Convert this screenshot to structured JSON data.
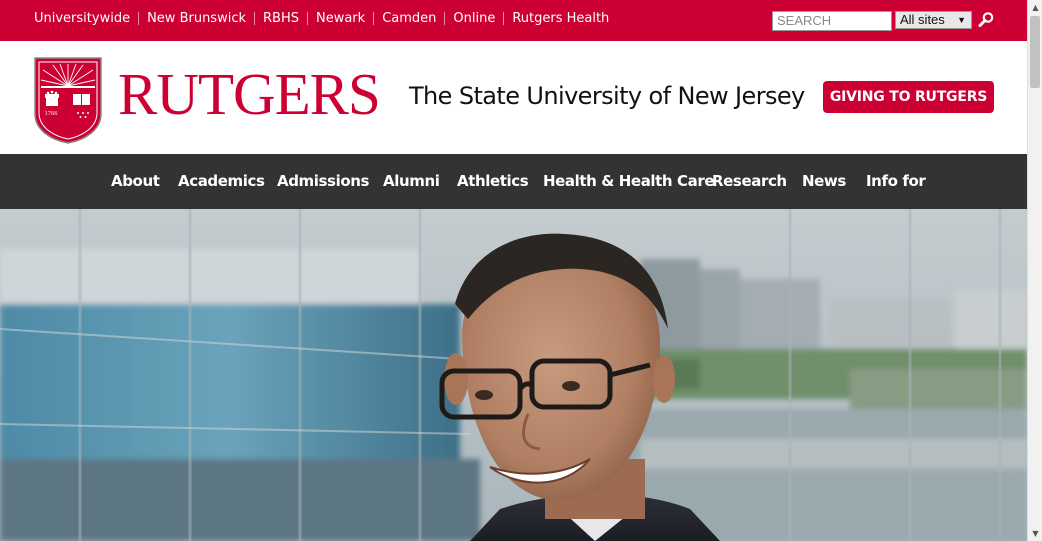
{
  "topbar": {
    "links": [
      "Universitywide",
      "New Brunswick",
      "RBHS",
      "Newark",
      "Camden",
      "Online",
      "Rutgers Health"
    ],
    "search_placeholder": "SEARCH",
    "site_select_value": "All sites",
    "search_icon": "magnifier-icon",
    "background": "#cc0033"
  },
  "header": {
    "seal_year": "1766",
    "wordmark": "RUTGERS",
    "tagline": "The State University of New Jersey",
    "giving_button": "GIVING TO RUTGERS",
    "brand_color": "#cc0033"
  },
  "nav": {
    "items": [
      "About",
      "Academics",
      "Admissions",
      "Alumni",
      "Athletics",
      "Health & Health Care",
      "Research",
      "News",
      "Info for"
    ],
    "background": "#333333"
  },
  "hero": {
    "image": "photo-portrait-man-glasses-smiling"
  }
}
